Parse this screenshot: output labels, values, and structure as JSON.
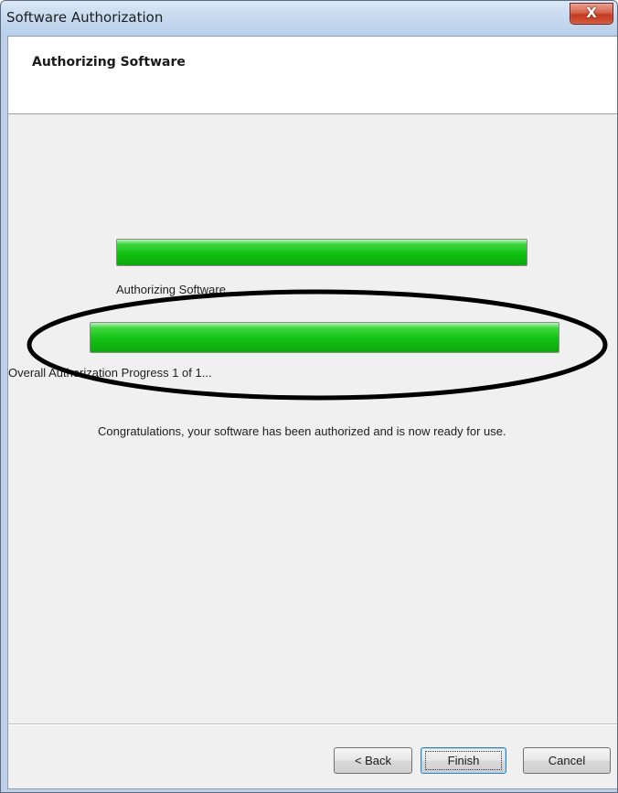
{
  "window": {
    "title": "Software Authorization",
    "close_glyph": "X"
  },
  "header": {
    "title": "Authorizing Software"
  },
  "progress": {
    "item": {
      "label": "Authorizing Software...",
      "percent": 100,
      "color": "#12c012"
    },
    "overall": {
      "label": "Overall Authorization Progress 1 of 1...",
      "percent": 100,
      "color": "#12c012"
    }
  },
  "message": "Congratulations, your software has been authorized and is now ready for use.",
  "buttons": {
    "back": "< Back",
    "finish": "Finish",
    "cancel": "Cancel"
  },
  "annotation": {
    "shape": "ellipse",
    "color": "#000000",
    "encloses": "overall-progress"
  }
}
